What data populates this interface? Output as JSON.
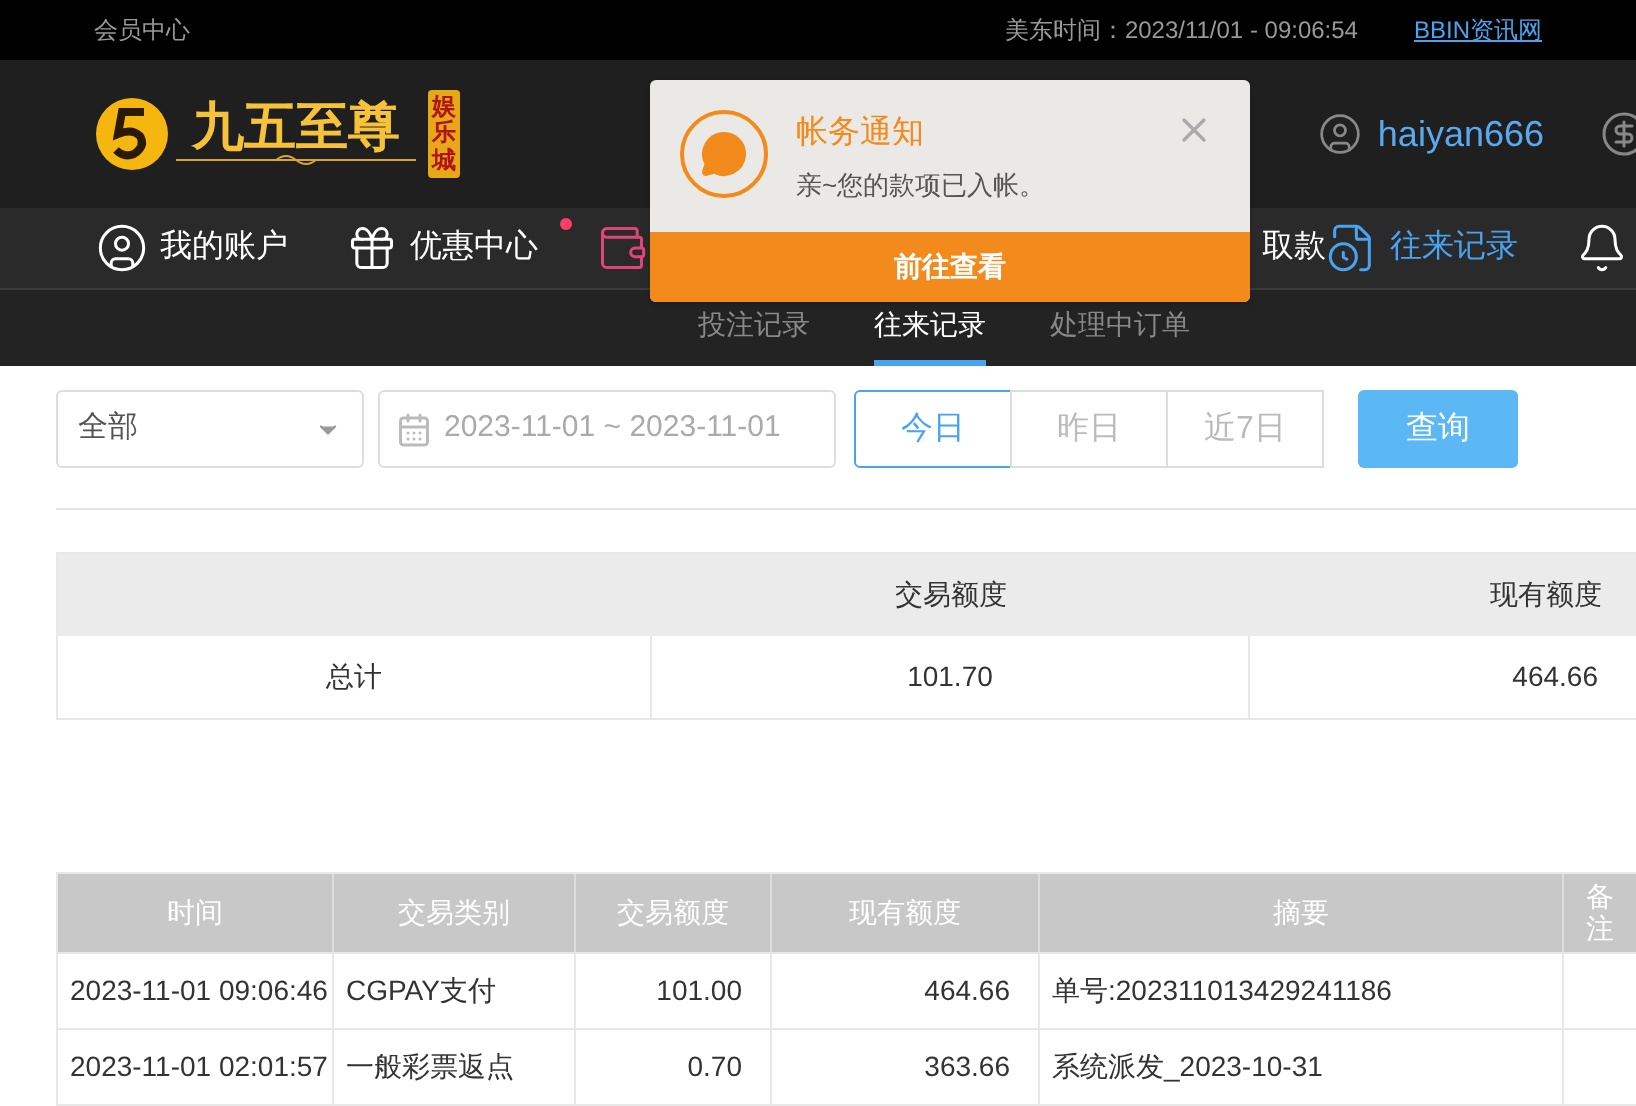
{
  "top_bar": {
    "member_center": "会员中心",
    "time": "美东时间：2023/11/01 - 09:06:54",
    "link": "BBIN资讯网"
  },
  "header": {
    "logo_name": "九五至尊",
    "logo_badge": "娱乐城",
    "username": "haiyan666"
  },
  "nav": [
    {
      "kind": "user",
      "label": "我的账户",
      "dot": false,
      "selected": false
    },
    {
      "kind": "gift",
      "label": "优惠中心",
      "dot": true,
      "selected": false
    },
    {
      "kind": "wallet",
      "dot": false,
      "selected": false
    },
    {
      "kind": "withdraw",
      "label": "取款",
      "dot": false,
      "selected": false
    },
    {
      "kind": "record",
      "label": "往来记录",
      "dot": false,
      "selected": true
    },
    {
      "kind": "bell",
      "dot": false,
      "selected": false
    }
  ],
  "notification": {
    "title": "帐务通知",
    "message": "亲~您的款项已入帐。",
    "action": "前往查看"
  },
  "sub_tabs": [
    {
      "label": "投注记录",
      "selected": false
    },
    {
      "label": "往来记录",
      "selected": true
    },
    {
      "label": "处理中订单",
      "selected": false
    }
  ],
  "filters": {
    "type_select": "全部",
    "date_range": "2023-11-01 ~ 2023-11-01",
    "ranges": [
      {
        "label": "今日",
        "selected": true
      },
      {
        "label": "昨日",
        "selected": false
      },
      {
        "label": "近7日",
        "selected": false
      }
    ],
    "query": "查询"
  },
  "summary": {
    "columns": [
      "交易额度",
      "现有额度"
    ],
    "row": [
      "总计",
      "101.70",
      "464.66"
    ]
  },
  "table": {
    "columns": [
      "时间",
      "交易类别",
      "交易额度",
      "现有额度",
      "摘要",
      "备注"
    ],
    "rows": [
      [
        "2023-11-01 09:06:46",
        "CGPAY支付",
        "101.00",
        "464.66",
        "单号:202311013429241186",
        ""
      ],
      [
        "2023-11-01 02:01:57",
        "一般彩票返点",
        "0.70",
        "363.66",
        "系统派发_2023-10-31",
        ""
      ]
    ]
  }
}
